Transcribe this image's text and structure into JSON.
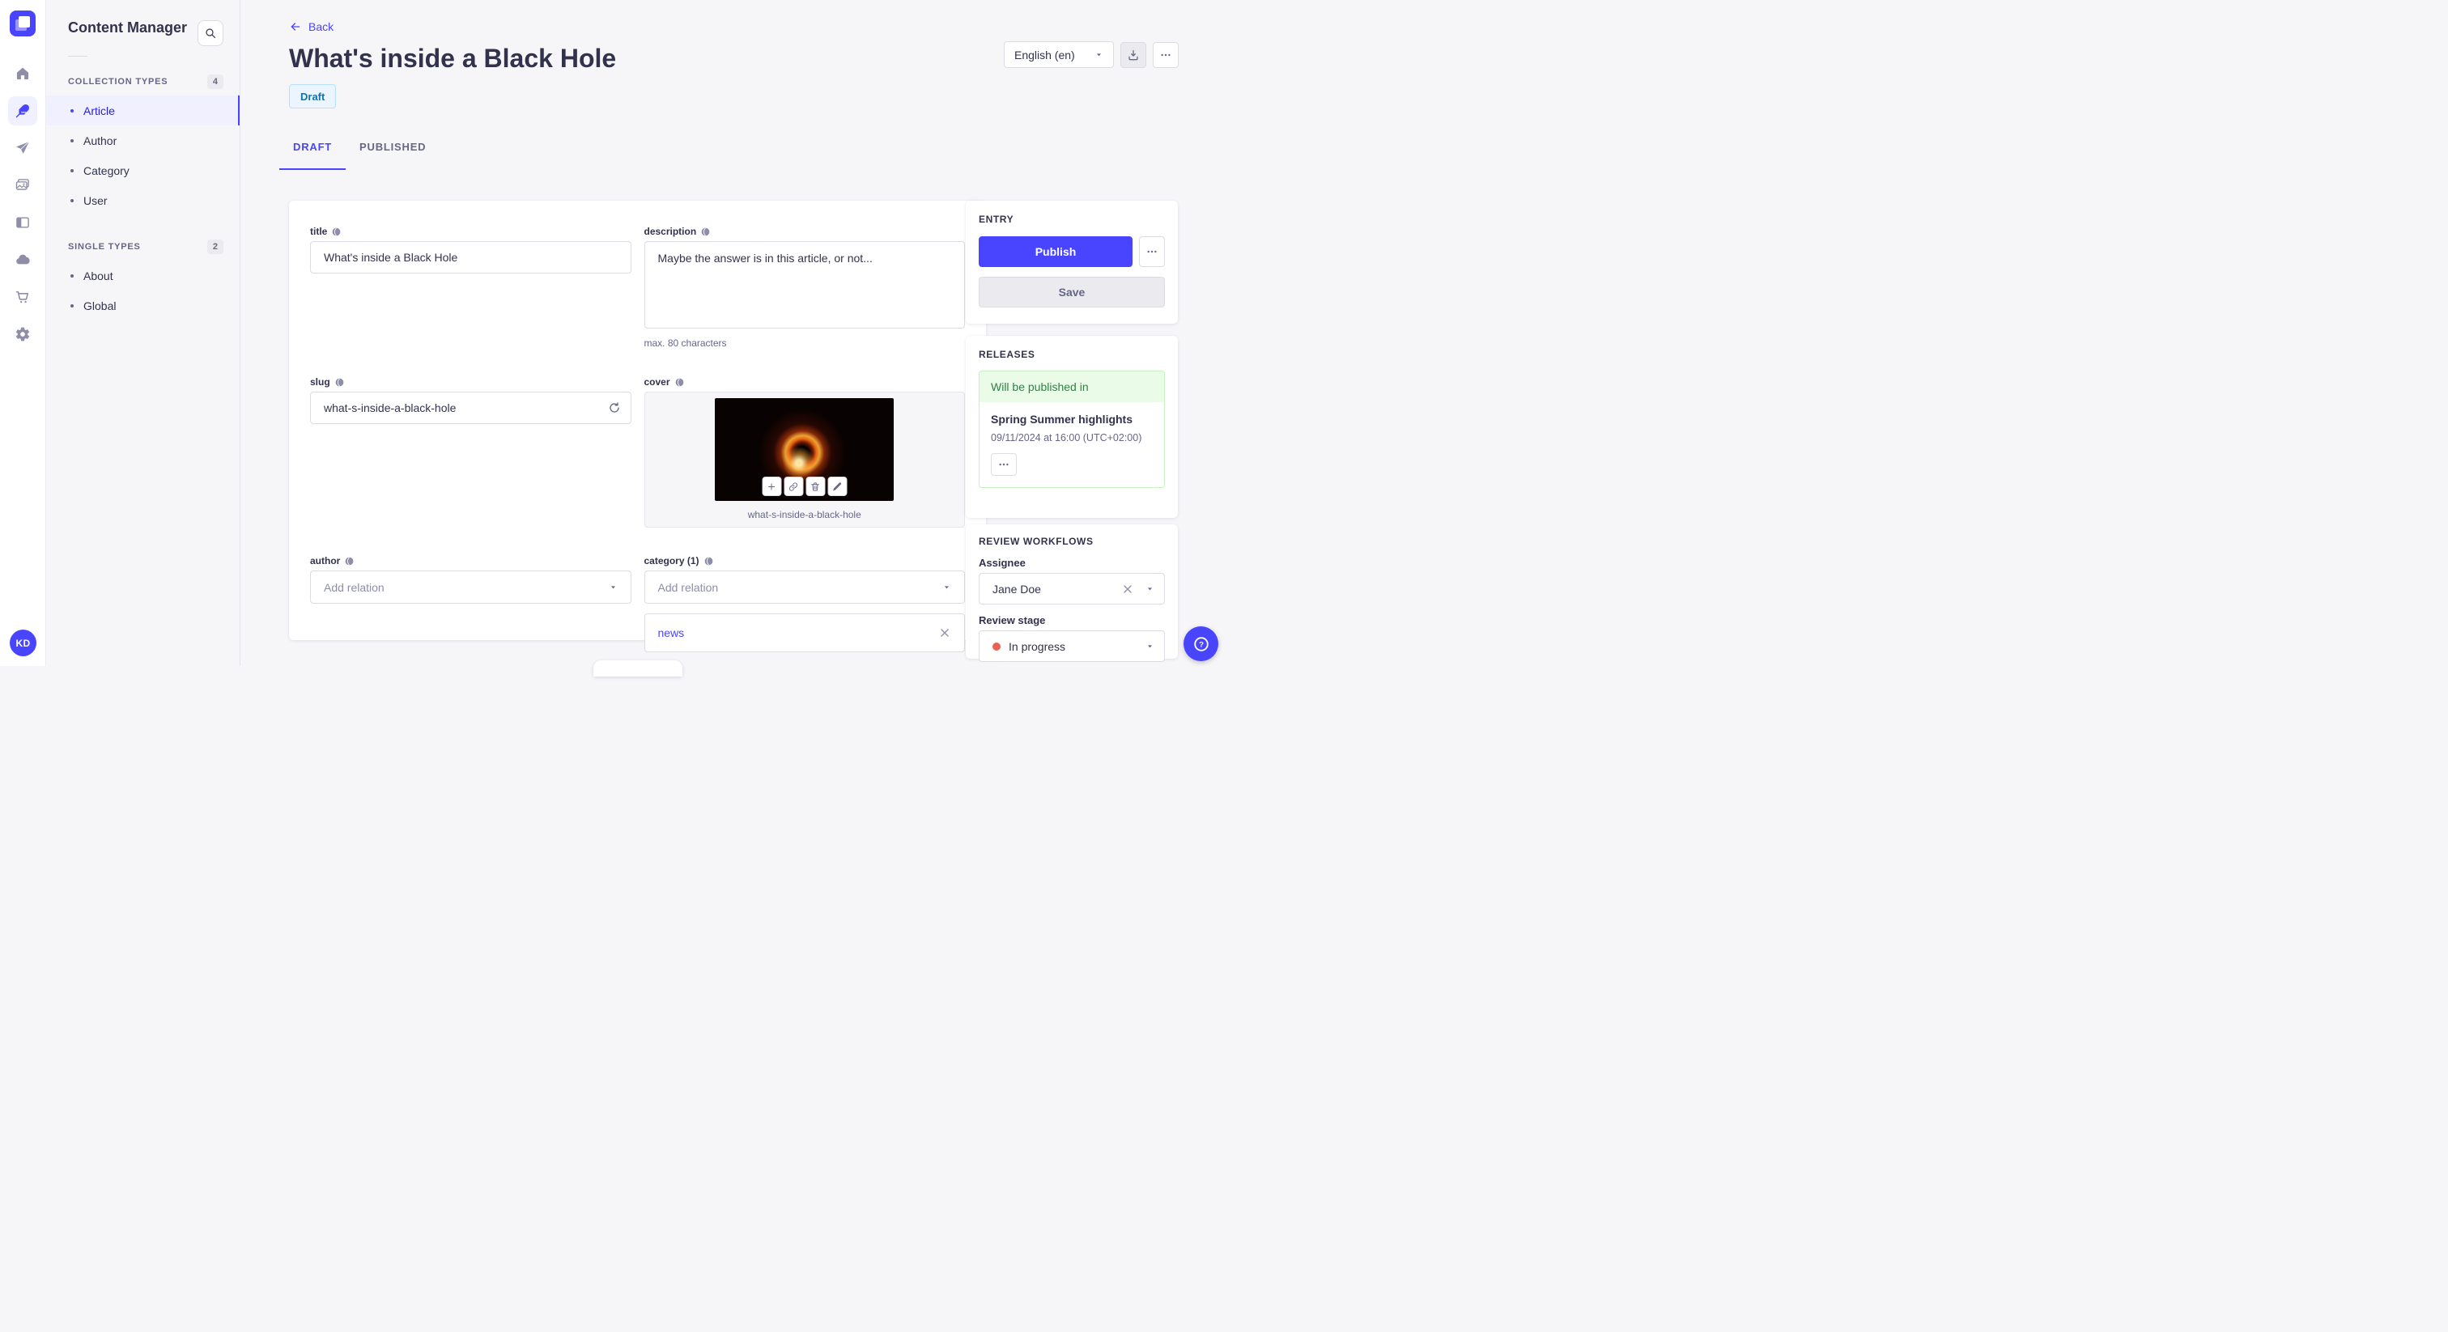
{
  "app": {
    "user_initials": "KD"
  },
  "sidebar": {
    "title": "Content Manager",
    "sections": [
      {
        "label": "COLLECTION TYPES",
        "count": "4",
        "items": [
          {
            "label": "Article"
          },
          {
            "label": "Author"
          },
          {
            "label": "Category"
          },
          {
            "label": "User"
          }
        ]
      },
      {
        "label": "SINGLE TYPES",
        "count": "2",
        "items": [
          {
            "label": "About"
          },
          {
            "label": "Global"
          }
        ]
      }
    ]
  },
  "header": {
    "back_label": "Back",
    "title": "What's inside a Black Hole",
    "status_badge": "Draft",
    "locale": "English (en)",
    "tabs": [
      {
        "label": "DRAFT"
      },
      {
        "label": "PUBLISHED"
      }
    ]
  },
  "form": {
    "title": {
      "label": "title",
      "value": "What's inside a Black Hole"
    },
    "description": {
      "label": "description",
      "value": "Maybe the answer is in this article, or not...",
      "hint": "max. 80 characters"
    },
    "slug": {
      "label": "slug",
      "value": "what-s-inside-a-black-hole"
    },
    "cover": {
      "label": "cover",
      "filename": "what-s-inside-a-black-hole"
    },
    "author": {
      "label": "author",
      "placeholder": "Add relation"
    },
    "category": {
      "label": "category (1)",
      "placeholder": "Add relation",
      "selected": "news"
    }
  },
  "entry_panel": {
    "heading": "ENTRY",
    "publish_label": "Publish",
    "save_label": "Save"
  },
  "releases_panel": {
    "heading": "RELEASES",
    "banner": "Will be published in",
    "release_name": "Spring Summer highlights",
    "release_date": "09/11/2024 at 16:00 (UTC+02:00)"
  },
  "review_panel": {
    "heading": "REVIEW WORKFLOWS",
    "assignee_label": "Assignee",
    "assignee_value": "Jane Doe",
    "stage_label": "Review stage",
    "stage_value": "In progress"
  },
  "colors": {
    "accent": "#4945ff",
    "draft_text": "#0c75af",
    "draft_bg": "#eaf5ff",
    "success_text": "#328048",
    "success_bg": "#eafbe7",
    "danger_dot": "#ee5e52"
  }
}
